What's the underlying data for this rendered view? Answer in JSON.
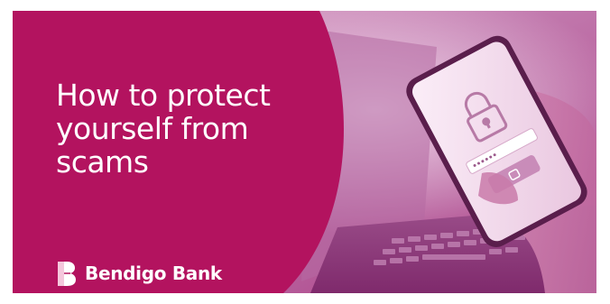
{
  "headline": {
    "lines": [
      "How to protect",
      "yourself from",
      "scams"
    ]
  },
  "brand": {
    "name": "Bendigo Bank",
    "logo_icon": "bendigo-b-logo-icon"
  },
  "photo": {
    "subject": "hand holding smartphone showing padlock and password field, laptop in background",
    "icons": [
      "padlock-icon",
      "password-field-icon",
      "phone-lock-icon"
    ]
  },
  "colors": {
    "brand_magenta": "#b3135f",
    "photo_tint": "#c65a9a",
    "text": "#ffffff"
  }
}
